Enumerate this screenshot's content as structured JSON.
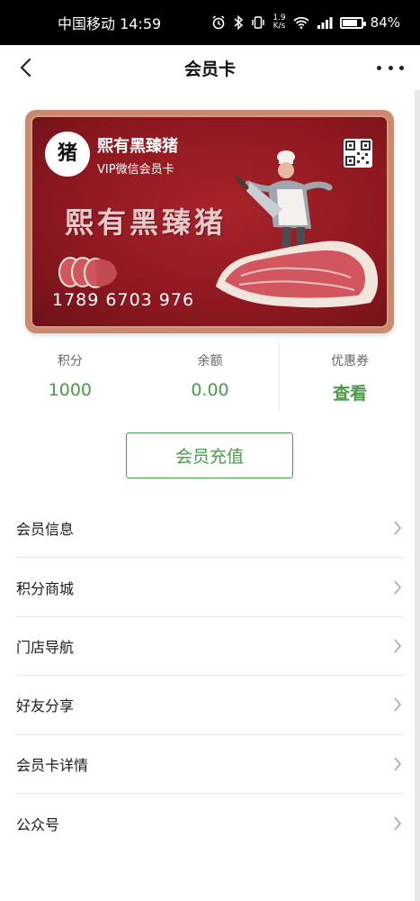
{
  "status_bar": {
    "carrier_time": "中国移动 14:59",
    "speed_value": "1.9",
    "speed_unit": "K/s",
    "battery": "84%",
    "battery_level": 0.84,
    "icons": [
      "alarm-icon",
      "bluetooth-icon",
      "vibrate-icon",
      "wifi-icon",
      "signal-icon",
      "battery-icon"
    ]
  },
  "nav": {
    "title": "会员卡",
    "back_icon": "chevron-left-icon",
    "more_icon": "more-dots-icon"
  },
  "card": {
    "logo_char": "猪",
    "brand": "熙有黑臻猪",
    "subtitle": "VIP微信会员卡",
    "slogan": "熙有黑臻猪",
    "number": "1789 6703 976",
    "qr_icon": "qr-code-icon",
    "colors": {
      "card_bg": "#a8232a",
      "card_border": "#c98a6f"
    }
  },
  "stats": [
    {
      "label": "积分",
      "value": "1000"
    },
    {
      "label": "余额",
      "value": "0.00"
    },
    {
      "label": "优惠券",
      "value": "查看"
    }
  ],
  "recharge_button": "会员充值",
  "menu": [
    {
      "label": "会员信息"
    },
    {
      "label": "积分商城"
    },
    {
      "label": "门店导航"
    },
    {
      "label": "好友分享"
    },
    {
      "label": "会员卡详情"
    },
    {
      "label": "公众号"
    }
  ],
  "colors": {
    "accent": "#4a9a4a",
    "divider": "#e9e9e9"
  }
}
